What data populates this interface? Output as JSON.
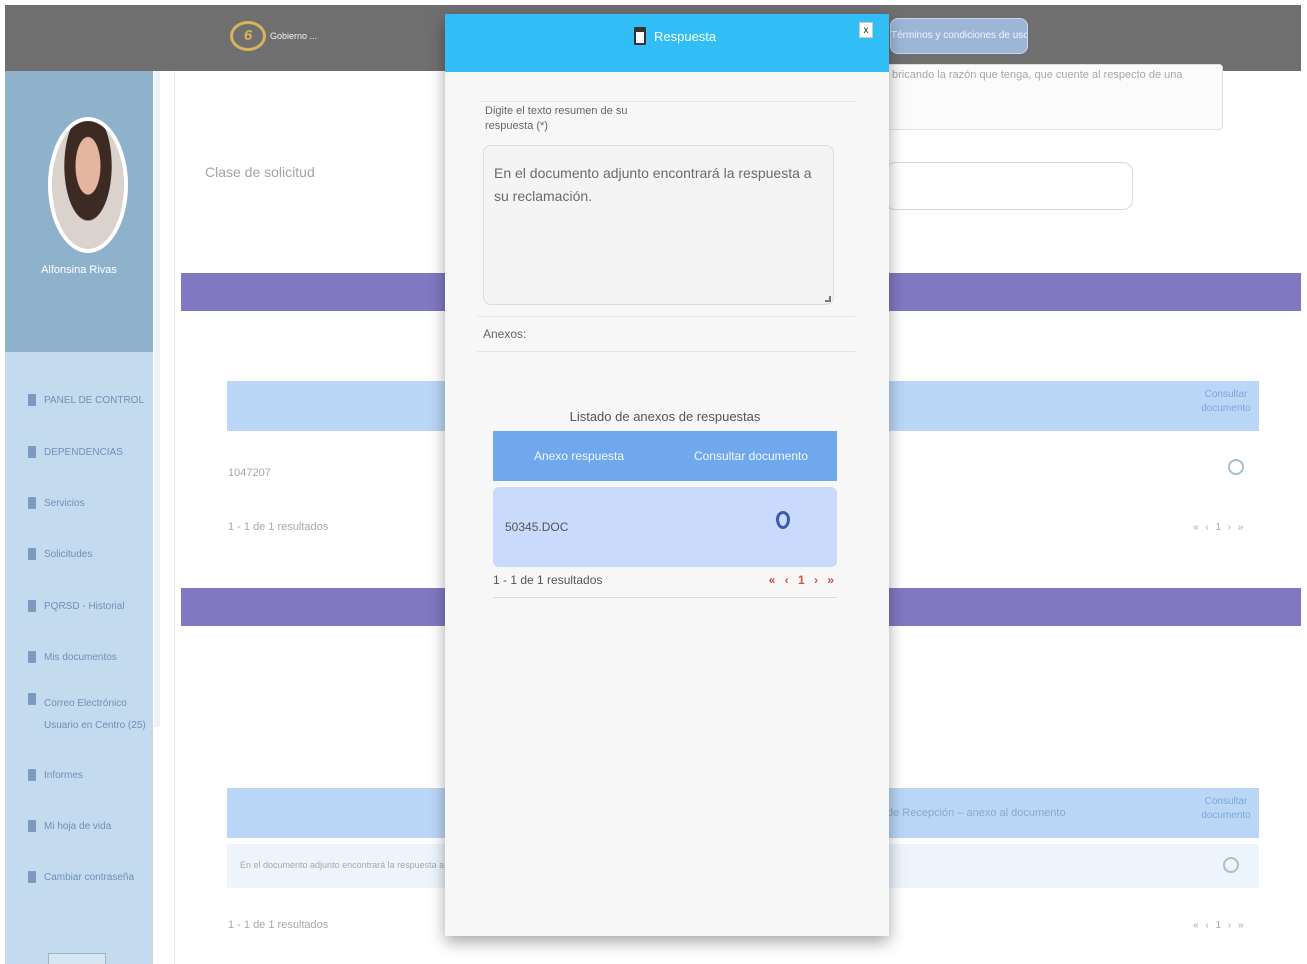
{
  "topbar": {
    "logo_mark": "6",
    "logo_text": "Gobierno ... ",
    "terms_button": "Términos y condiciones de uso"
  },
  "sidebar": {
    "profile_name": "Alfonsina Rivas",
    "items": [
      {
        "label": "PANEL DE CONTROL",
        "icon": "dashboard-icon"
      },
      {
        "label": "DEPENDENCIAS",
        "icon": "building-icon"
      },
      {
        "label": "Servicios",
        "icon": "service-icon"
      },
      {
        "label": "Solicitudes",
        "icon": "request-icon"
      },
      {
        "label": "PQRSD - Historial",
        "icon": "history-icon"
      },
      {
        "label": "Mis documentos",
        "icon": "document-icon"
      },
      {
        "label": "Correo Electrónico",
        "subtitle": "Usuario en Centro (25)",
        "icon": "mail-icon"
      },
      {
        "label": "Informes",
        "icon": "report-icon"
      },
      {
        "label": "Mi hoja de vida",
        "icon": "profile-icon"
      },
      {
        "label": "Cambiar contraseña",
        "icon": "key-icon"
      }
    ]
  },
  "background": {
    "field_label": "Clase de solicitud",
    "textarea_text": "bricando la razón que tenga, que cuente al respecto de una",
    "table1": {
      "head_right": "Consultar documento",
      "row_text": "1047207",
      "count": "1 - 1 de 1 resultados",
      "pager": "« ‹ 1 › »"
    },
    "table2": {
      "head_middle": "de Recepción – anexo al documento",
      "head_right": "Consultar documento",
      "row_text": "En el documento adjunto encontrará la respuesta a",
      "count": "1 - 1 de 1 resultados",
      "pager": "« ‹ 1 › »"
    }
  },
  "modal": {
    "title": "Respuesta",
    "close_label": "x",
    "response_label": "Digite el texto resumen de su respuesta (*)",
    "response_text": "En el documento adjunto encontrará la respuesta a su reclamación.",
    "anexos_label": "Anexos:",
    "list_title": "Listado de anexos de respuestas",
    "columns": [
      "Anexo respuesta",
      "Consultar documento"
    ],
    "rows": [
      {
        "anexo": "50345.DOC"
      }
    ],
    "count": "1 - 1 de 1 resultados",
    "pager": "« ‹ 1 › »"
  }
}
